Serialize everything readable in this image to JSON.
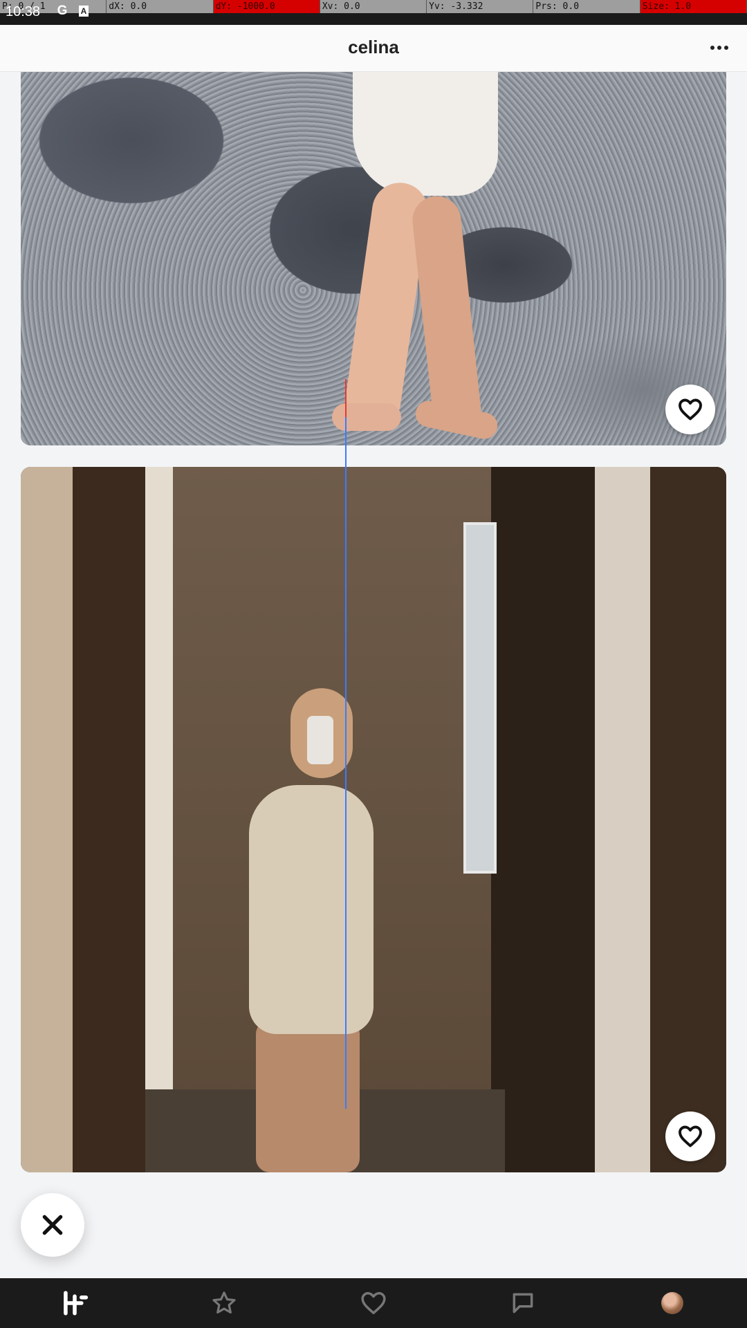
{
  "status_bar": {
    "time": "10:38",
    "icons": [
      "google-icon",
      "font-icon"
    ]
  },
  "debug_bar": {
    "cells": [
      "P: 0 / 1",
      "dX: 0.0",
      "dY: -1000.0",
      "Xv: 0.0",
      "Yv: -3.332",
      "Prs: 0.0",
      "Size: 1.0"
    ]
  },
  "header": {
    "title": "celina",
    "menu": "more-icon"
  },
  "feed": {
    "cards": [
      {
        "like": "heart-icon"
      },
      {
        "like": "heart-icon"
      }
    ]
  },
  "fab": {
    "icon": "close-icon"
  },
  "bottom_nav": {
    "items": [
      "home-icon",
      "star-icon",
      "heart-icon",
      "chat-icon",
      "profile-avatar"
    ],
    "active": "home-icon"
  },
  "colors": {
    "nav_bg": "#1b1b1b",
    "header_bg": "#fafafa",
    "page_bg": "#f3f4f6",
    "touch_line": "#3b7bff"
  }
}
